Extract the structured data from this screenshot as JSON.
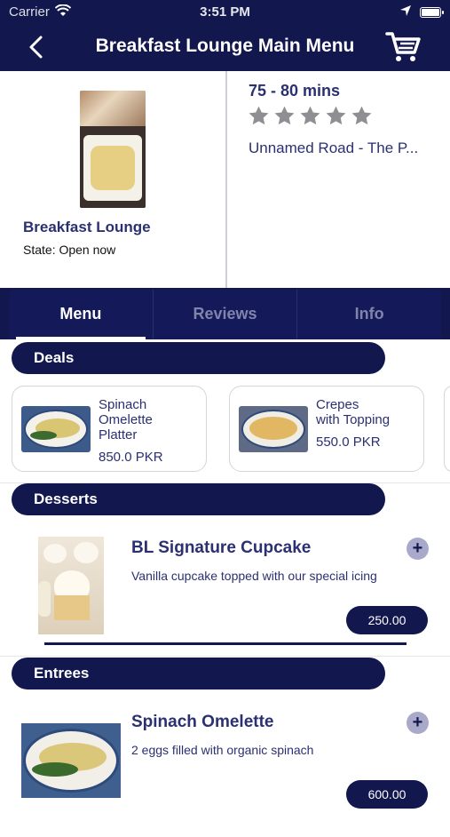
{
  "status": {
    "carrier": "Carrier",
    "time": "3:51 PM"
  },
  "nav": {
    "title": "Breakfast Lounge Main Menu"
  },
  "restaurant": {
    "name": "Breakfast Lounge",
    "state": "State: Open now",
    "delivery_time": "75 - 80 mins",
    "rating": 0,
    "rating_max": 5,
    "address": "Unnamed Road - The P..."
  },
  "tabs": [
    {
      "label": "Menu",
      "active": true
    },
    {
      "label": "Reviews",
      "active": false
    },
    {
      "label": "Info",
      "active": false
    }
  ],
  "sections": {
    "deals": "Deals",
    "desserts": "Desserts",
    "entrees": "Entrees"
  },
  "deals": [
    {
      "name_lines": [
        "Spinach",
        "Omelette",
        "Platter"
      ],
      "price": "850.0 PKR"
    },
    {
      "name_lines": [
        "Crepes",
        "with Topping"
      ],
      "price": "550.0 PKR"
    }
  ],
  "items": [
    {
      "title": "BL Signature Cupcake",
      "description": "Vanilla cupcake topped with our special icing",
      "price": "250.00 PKR"
    },
    {
      "title": "Spinach Omelette",
      "description": "2 eggs filled with organic spinach",
      "price": "600.00 PKR"
    }
  ],
  "colors": {
    "navy": "#12174e",
    "text_navy": "#2b3070",
    "star_gray": "#8e8e93"
  }
}
